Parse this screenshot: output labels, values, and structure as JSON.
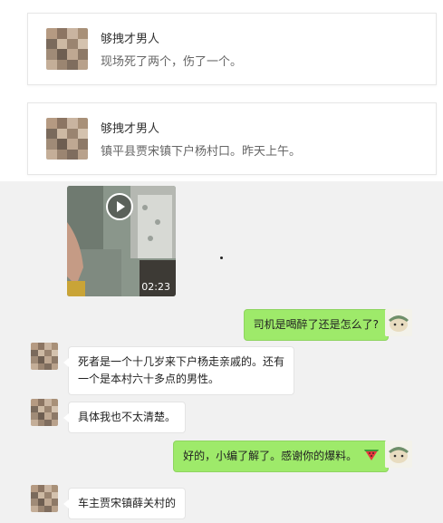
{
  "cards": [
    {
      "name": "够拽才男人",
      "message": "现场死了两个，伤了一个。"
    },
    {
      "name": "够拽才男人",
      "message": "镇平县贾宋镇下户杨村口。昨天上午。"
    }
  ],
  "video": {
    "duration": "02:23"
  },
  "messages": [
    {
      "side": "right",
      "text": "司机是喝醉了还是怎么了?"
    },
    {
      "side": "left",
      "line1": "死者是一个十几岁来下户杨走亲戚的。还有",
      "line2": "一个是本村六十多点的男性。"
    },
    {
      "side": "left",
      "text": "具体我也不太清楚。"
    },
    {
      "side": "right",
      "text": "好的，小编了解了。感谢你的爆料。",
      "emoji": "watermelon-icon"
    },
    {
      "side": "left",
      "text": "车主贾宋镇薛关村的"
    }
  ],
  "colors": {
    "sent_bubble": "#9eea6a",
    "chat_bg": "#f1f1f1"
  }
}
